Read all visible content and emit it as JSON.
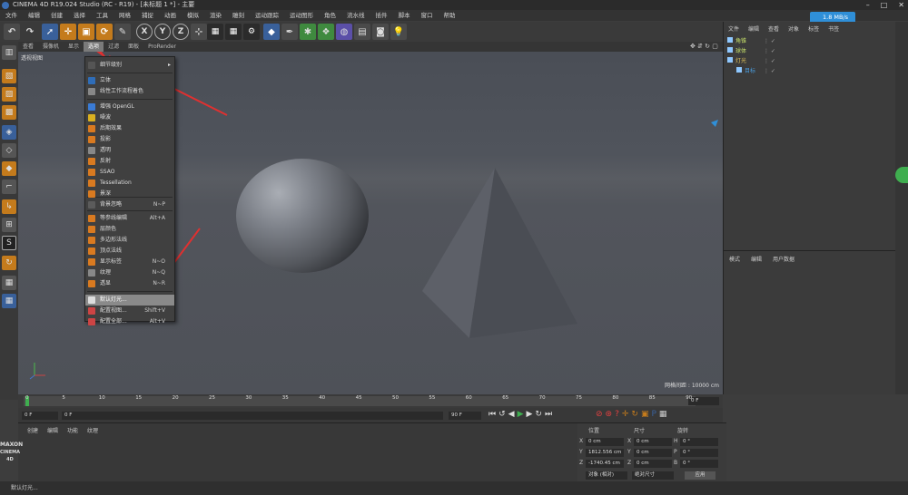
{
  "window": {
    "title": "CINEMA 4D R19.024 Studio (RC - R19) - [未标题 1 *] - 主要"
  },
  "menubar": [
    "文件",
    "编辑",
    "创建",
    "选择",
    "工具",
    "网格",
    "捕捉",
    "动画",
    "模拟",
    "渲染",
    "雕刻",
    "运动跟踪",
    "运动图形",
    "角色",
    "流水线",
    "插件",
    "脚本",
    "窗口",
    "帮助"
  ],
  "net_badge": "1.8 MB/s",
  "toolbar": {
    "x_label": "X",
    "y_label": "Y",
    "z_label": "Z"
  },
  "viewport_menu": [
    "查看",
    "摄像机",
    "显示",
    "选项",
    "过滤",
    "面板",
    "ProRender"
  ],
  "viewport": {
    "label": "透视视图",
    "grid_spacing": "网格间距 : 10000 cm"
  },
  "options_menu": {
    "items": [
      {
        "label": "细节级别",
        "shortcut": ""
      },
      {
        "label": "立体",
        "shortcut": ""
      },
      {
        "label": "线性工作流程着色",
        "shortcut": ""
      },
      {
        "label": "增强 OpenGL",
        "shortcut": ""
      },
      {
        "label": "噪波",
        "shortcut": ""
      },
      {
        "label": "后期效果",
        "shortcut": ""
      },
      {
        "label": "投影",
        "shortcut": ""
      },
      {
        "label": "透明",
        "shortcut": ""
      },
      {
        "label": "反射",
        "shortcut": ""
      },
      {
        "label": "SSAO",
        "shortcut": ""
      },
      {
        "label": "Tessellation",
        "shortcut": ""
      },
      {
        "label": "景深",
        "shortcut": ""
      },
      {
        "label": "背景忽略",
        "shortcut": "N~P"
      },
      {
        "label": "等参线编辑",
        "shortcut": "Alt+A"
      },
      {
        "label": "层颜色",
        "shortcut": ""
      },
      {
        "label": "多边形法线",
        "shortcut": ""
      },
      {
        "label": "顶点法线",
        "shortcut": ""
      },
      {
        "label": "显示标签",
        "shortcut": "N~O"
      },
      {
        "label": "纹理",
        "shortcut": "N~Q"
      },
      {
        "label": "透显",
        "shortcut": "N~R"
      },
      {
        "label": "默认灯光...",
        "shortcut": ""
      },
      {
        "label": "配置视图...",
        "shortcut": "Shift+V"
      },
      {
        "label": "配置全部...",
        "shortcut": "Alt+V"
      }
    ]
  },
  "object_manager": {
    "menu": [
      "文件",
      "编辑",
      "查看",
      "对象",
      "标签",
      "书签"
    ],
    "objects": [
      "角锥",
      "球体",
      "灯光",
      "目标"
    ]
  },
  "attribute_manager": {
    "menu": [
      "模式",
      "编辑",
      "用户数据"
    ]
  },
  "timeline": {
    "ticks": [
      "0",
      "5",
      "10",
      "15",
      "20",
      "25",
      "30",
      "35",
      "40",
      "45",
      "50",
      "55",
      "60",
      "65",
      "70",
      "75",
      "80",
      "85",
      "90"
    ],
    "end_frame": "0 F"
  },
  "playbar": {
    "start": "0 F",
    "current": "0 F",
    "end": "90 F",
    "end2": "90 F"
  },
  "lower_tabs": [
    "创建",
    "编辑",
    "功能",
    "纹理"
  ],
  "coords": {
    "headers": [
      "位置",
      "尺寸",
      "旋转"
    ],
    "rows": [
      {
        "axis": "X",
        "pos": "0 cm",
        "size_axis": "X",
        "size": "0 cm",
        "rot_axis": "H",
        "rot": "0 °"
      },
      {
        "axis": "Y",
        "pos": "1812.556 cm",
        "size_axis": "Y",
        "size": "0 cm",
        "rot_axis": "P",
        "rot": "0 °"
      },
      {
        "axis": "Z",
        "pos": "-1740.45 cm",
        "size_axis": "Z",
        "size": "0 cm",
        "rot_axis": "B",
        "rot": "0 °"
      }
    ],
    "mode": "对象 (相对)",
    "size_mode": "绝对尺寸",
    "apply": "应用"
  },
  "status_bar": "默认灯光...",
  "brand": [
    "MAXON",
    "CINEMA 4D"
  ]
}
